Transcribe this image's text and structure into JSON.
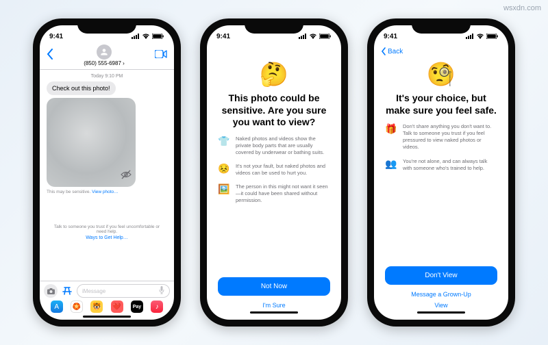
{
  "watermark": "wsxdn.com",
  "status": {
    "time": "9:41"
  },
  "phone1": {
    "contact": "(850) 555-6987",
    "timestamp": "Today 9:10 PM",
    "message": "Check out this photo!",
    "sensitive_prefix": "This may be sensitive.",
    "view_photo": "View photo…",
    "help_text": "Talk to someone you trust if you feel uncomfortable or need help.",
    "help_link": "Ways to Get Help…",
    "compose_placeholder": "iMessage"
  },
  "phone2": {
    "title": "This photo could be sensitive. Are you sure you want to view?",
    "items": [
      {
        "icon": "👕",
        "text": "Naked photos and videos show the private body parts that are usually covered by underwear or bathing suits."
      },
      {
        "icon": "😣",
        "text": "It's not your fault, but naked photos and videos can be used to hurt you."
      },
      {
        "icon": "🖼️",
        "text": "The person in this might not want it seen—it could have been shared without permission."
      }
    ],
    "primary": "Not Now",
    "secondary": "I'm Sure"
  },
  "phone3": {
    "back": "Back",
    "title": "It's your choice, but make sure you feel safe.",
    "items": [
      {
        "icon": "🎁",
        "text": "Don't share anything you don't want to. Talk to someone you trust if you feel pressured to view naked photos or videos."
      },
      {
        "icon": "👥",
        "text": "You're not alone, and can always talk with someone who's trained to help."
      }
    ],
    "primary": "Don't View",
    "secondary1": "Message a Grown-Up",
    "secondary2": "View"
  }
}
